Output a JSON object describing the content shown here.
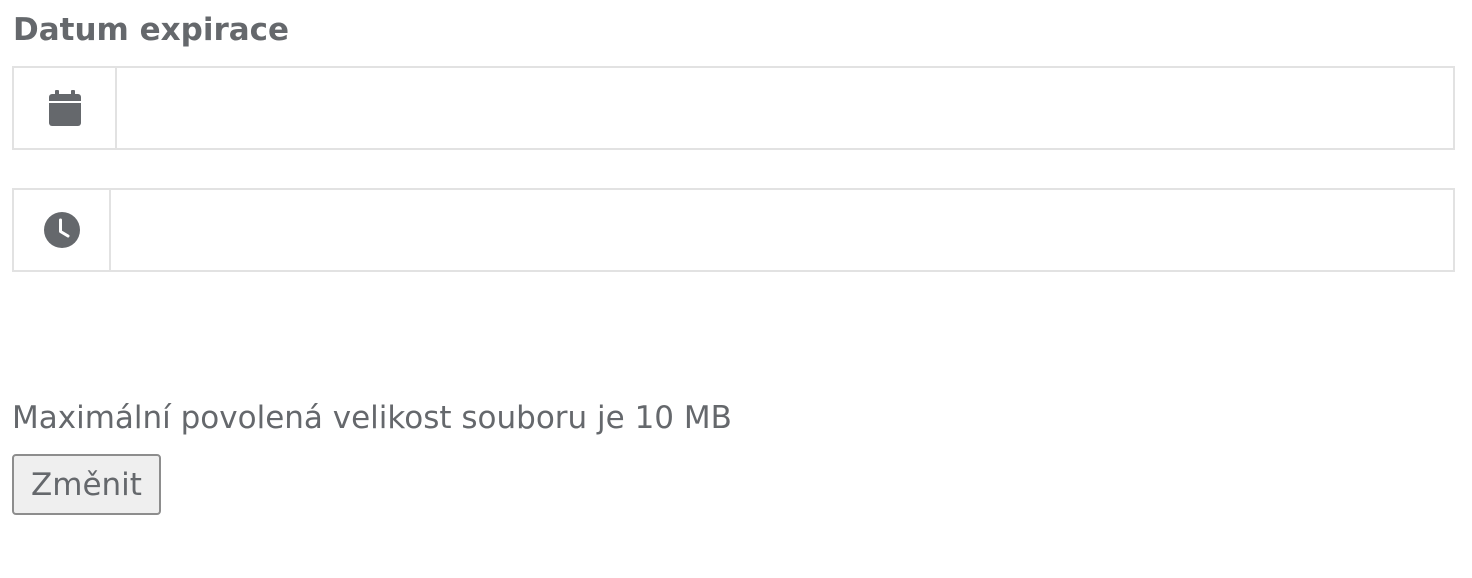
{
  "expiration": {
    "label": "Datum expirace",
    "date_input": {
      "icon": "calendar-icon",
      "value": "",
      "placeholder": ""
    },
    "time_input": {
      "icon": "clock-icon",
      "value": "",
      "placeholder": ""
    }
  },
  "upload": {
    "max_size_text": "Maximální povolená velikost souboru je 10 MB",
    "change_button_label": "Změnit"
  },
  "colors": {
    "text": "#65686c",
    "border": "#e2e2e2",
    "icon": "#65686c",
    "button_bg": "#efefef",
    "button_border": "#8d8d8d"
  }
}
